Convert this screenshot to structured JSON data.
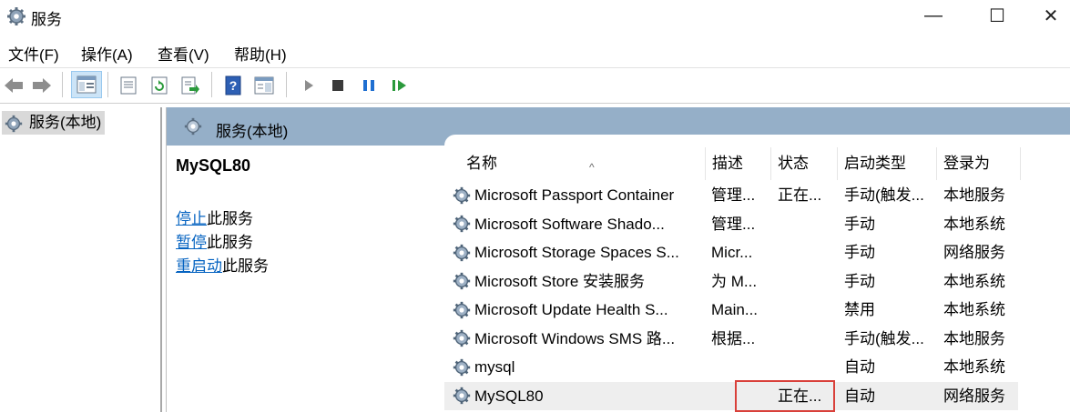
{
  "window": {
    "title": "服务",
    "minimize": "—",
    "maximize": "☐",
    "close": "✕"
  },
  "menu": [
    "文件(F)",
    "操作(A)",
    "查看(V)",
    "帮助(H)"
  ],
  "toolbar_icons": [
    "back-arrow-icon",
    "forward-arrow-icon",
    "show-hide-tree-icon",
    "properties-icon",
    "refresh-icon",
    "export-list-icon",
    "help-icon",
    "console-view-icon",
    "start-service-icon",
    "stop-service-icon",
    "pause-service-icon",
    "restart-service-icon"
  ],
  "tree": {
    "root_label": "服务(本地)"
  },
  "pane": {
    "header_title": "服务(本地)"
  },
  "detail": {
    "service_name": "MySQL80",
    "actions": [
      {
        "link": "停止",
        "suffix": "此服务"
      },
      {
        "link": "暂停",
        "suffix": "此服务"
      },
      {
        "link": "重启动",
        "suffix": "此服务"
      }
    ]
  },
  "table": {
    "sort_indicator": "^",
    "columns": [
      "名称",
      "描述",
      "状态",
      "启动类型",
      "登录为"
    ],
    "rows": [
      {
        "name": "Microsoft Passport Container",
        "desc": "管理...",
        "status": "正在...",
        "startup": "手动(触发...",
        "logon": "本地服务"
      },
      {
        "name": "Microsoft Software Shado...",
        "desc": "管理...",
        "status": "",
        "startup": "手动",
        "logon": "本地系统"
      },
      {
        "name": "Microsoft Storage Spaces S...",
        "desc": "Micr...",
        "status": "",
        "startup": "手动",
        "logon": "网络服务"
      },
      {
        "name": "Microsoft Store 安装服务",
        "desc": "为 M...",
        "status": "",
        "startup": "手动",
        "logon": "本地系统"
      },
      {
        "name": "Microsoft Update Health S...",
        "desc": "Main...",
        "status": "",
        "startup": "禁用",
        "logon": "本地系统"
      },
      {
        "name": "Microsoft Windows SMS 路...",
        "desc": "根据...",
        "status": "",
        "startup": "手动(触发...",
        "logon": "本地服务"
      },
      {
        "name": "mysql",
        "desc": "",
        "status": "",
        "startup": "自动",
        "logon": "本地系统"
      },
      {
        "name": "MySQL80",
        "desc": "",
        "status": "正在...",
        "startup": "自动",
        "logon": "网络服务"
      }
    ],
    "selected_row": 7,
    "highlight_color": "#d9403a"
  }
}
